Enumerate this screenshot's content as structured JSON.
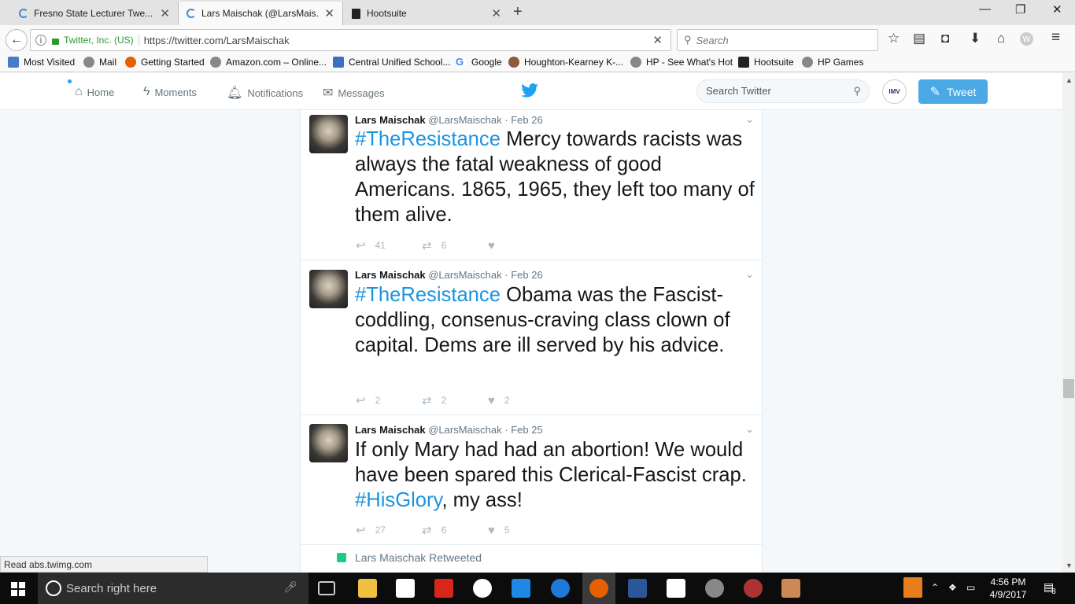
{
  "browser": {
    "tabs": [
      {
        "title": "Fresno State Lecturer Twe...",
        "icon": "loading-spinner"
      },
      {
        "title": "Lars Maischak (@LarsMais...",
        "icon": "loading-spinner",
        "active": true
      },
      {
        "title": "Hootsuite",
        "icon": "hootsuite-icon"
      }
    ],
    "url_site": "Twitter, Inc. (US)",
    "url": "https://twitter.com/LarsMaischak",
    "search_placeholder": "Search",
    "bookmarks": [
      "Most Visited",
      "Mail",
      "Getting Started",
      "Amazon.com – Online...",
      "Central Unified School...",
      "Google",
      "Houghton-Kearney K-...",
      "HP - See What's Hot",
      "Hootsuite",
      "HP Games"
    ],
    "status_text": "Read abs.twimg.com"
  },
  "twitter_nav": {
    "items": [
      "Home",
      "Moments",
      "Notifications",
      "Messages"
    ],
    "search_placeholder": "Search Twitter",
    "tweet_button": "Tweet",
    "accent": "#1da1f2"
  },
  "tweets": [
    {
      "name": "Lars Maischak",
      "handle": "@LarsMaischak",
      "date": "· Feb 26",
      "hashtag": "#TheResistance",
      "text": " Mercy towards racists was always the fatal weakness of good Americans.  1865, 1965, they left too many of them alive.",
      "replies": "41",
      "retweets": "6",
      "likes": ""
    },
    {
      "name": "Lars Maischak",
      "handle": "@LarsMaischak",
      "date": "· Feb 26",
      "hashtag": "#TheResistance",
      "text": " Obama was the Fascist-coddling, consenus-craving class clown of capital.  Dems are ill served by his advice.",
      "replies": "2",
      "retweets": "2",
      "likes": "2"
    },
    {
      "name": "Lars Maischak",
      "handle": "@LarsMaischak",
      "date": "· Feb 25",
      "pre": "If only Mary had had an abortion!  We would have been spared this Clerical-Fascist crap. ",
      "hashtag": "#HisGlory",
      "post": ", my ass!",
      "replies": "27",
      "retweets": "6",
      "likes": "5"
    }
  ],
  "retweet_label": "Lars Maischak Retweeted",
  "taskbar": {
    "search_placeholder": "Search right here",
    "time": "4:56 PM",
    "date": "4/9/2017",
    "notification_count": "8"
  }
}
